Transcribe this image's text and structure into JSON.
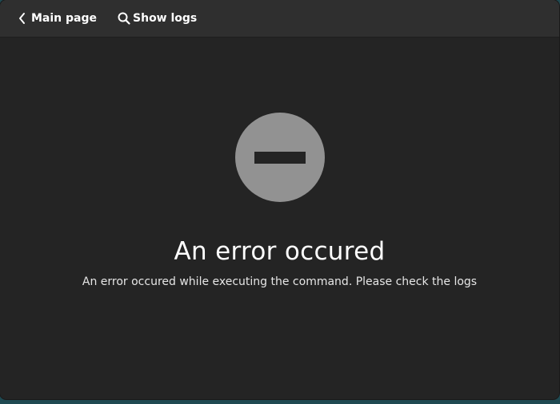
{
  "header": {
    "back_button": {
      "label": "Main page",
      "icon": "chevron-left-icon"
    },
    "logs_button": {
      "label": "Show logs",
      "icon": "search-icon"
    }
  },
  "status": {
    "icon": "no-entry-icon",
    "title": "An error occured",
    "description": "An error occured while executing the command. Please check the logs"
  },
  "colors": {
    "window_bg": "#242424",
    "headerbar_bg": "#2f2f2f",
    "icon_circle": "#929292",
    "desktop_bg": "#1f4a52"
  }
}
